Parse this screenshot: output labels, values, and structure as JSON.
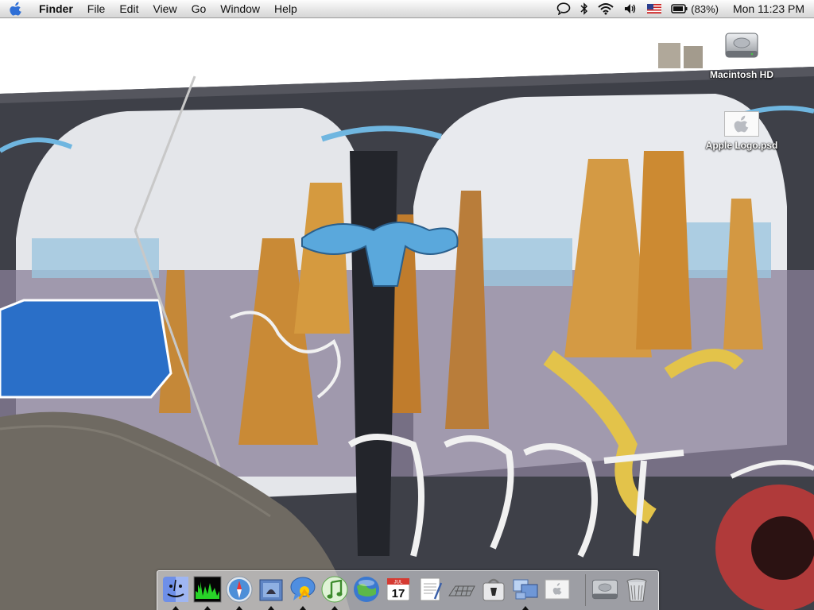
{
  "menubar": {
    "app_name": "Finder",
    "menus": [
      "File",
      "Edit",
      "View",
      "Go",
      "Window",
      "Help"
    ],
    "battery_percent": "(83%)",
    "clock": "Mon 11:23 PM"
  },
  "desktop_icons": [
    {
      "label": "Macintosh HD",
      "icon": "hard-drive-icon"
    },
    {
      "label": "Apple Logo.psd",
      "icon": "psd-file-icon"
    }
  ],
  "dock": {
    "apps": [
      {
        "name": "finder-icon",
        "running": true
      },
      {
        "name": "activity-monitor-icon",
        "running": true
      },
      {
        "name": "safari-icon",
        "running": true
      },
      {
        "name": "mail-icon",
        "running": true
      },
      {
        "name": "ichat-icon",
        "running": true
      },
      {
        "name": "itunes-icon",
        "running": true
      },
      {
        "name": "iphoto-icon",
        "running": false
      },
      {
        "name": "ical-icon",
        "running": false
      },
      {
        "name": "textedit-icon",
        "running": false
      },
      {
        "name": "terminal-icon",
        "running": false
      },
      {
        "name": "preview-icon",
        "running": false
      },
      {
        "name": "expose-icon",
        "running": true
      },
      {
        "name": "apple-preferences-icon",
        "running": false
      }
    ],
    "docs": [
      {
        "name": "hard-drive-icon",
        "running": false
      },
      {
        "name": "trash-icon",
        "running": false
      }
    ],
    "ical_date": "17",
    "ical_month": "JUL"
  },
  "colors": {
    "wall_gray": "#4a4a52",
    "arch_white": "#e6e8ec",
    "spire_orange": "#d08a2a",
    "sky_blue": "#7dbfe0",
    "gravel": "#6e6a62",
    "sky": "#ffffff"
  }
}
